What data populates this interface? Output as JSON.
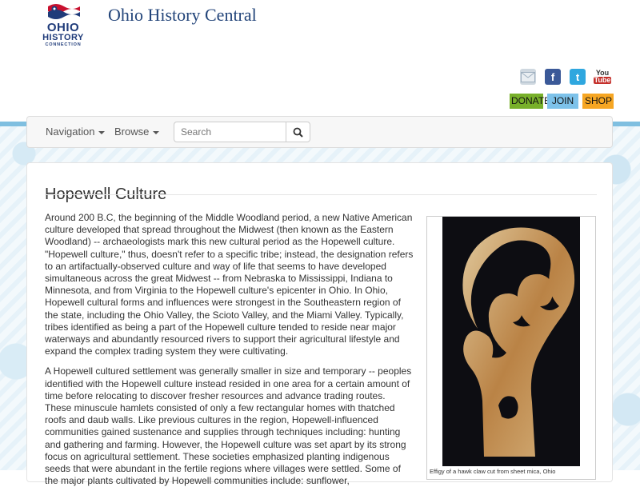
{
  "logo": {
    "line1": "OHIO",
    "line2": "HISTORY",
    "line3": "CONNECTION"
  },
  "site_title": "Ohio History Central",
  "social": {
    "mail_icon": "mail-icon",
    "facebook_glyph": "f",
    "twitter_glyph": "t",
    "youtube_you": "You",
    "youtube_tube": "Tube"
  },
  "actions": {
    "donate": "DONATE",
    "join": "JOIN",
    "shop": "SHOP"
  },
  "nav": {
    "navigation_label": "Navigation",
    "browse_label": "Browse",
    "search_placeholder": "Search"
  },
  "page": {
    "title": "Hopewell Culture",
    "paragraphs": [
      "Around 200 B.C, the beginning of the Middle Woodland period, a new Native American culture developed that spread throughout the Midwest (then known as the Eastern Woodland) -- archaeologists mark this new cultural period as the Hopewell culture. \"Hopewell culture,\" thus, doesn't refer to a specific tribe; instead, the designation refers to an artifactually-observed culture and way of life that seems to have developed simultaneous across the great Midwest -- from Nebraska to Mississippi, Indiana to Minnesota, and from Virginia to the Hopewell culture's epicenter in Ohio. In Ohio, Hopewell cultural forms and influences were strongest in the Southeastern region of the state, including the Ohio Valley, the Scioto Valley, and the Miami Valley. Typically, tribes identified as being a part of the Hopewell culture tended to reside near major waterways and abundantly resourced rivers to support their agricultural lifestyle and expand the complex trading system they were cultivating.",
      "A Hopewell cultured settlement was generally smaller in size and temporary -- peoples identified with the Hopewell culture instead resided in one area for a certain amount of time before relocating to discover fresher resources and advance trading routes. These minuscule hamlets consisted of only a few rectangular homes with thatched roofs and daub walls. Like previous cultures in the region, Hopewell-influenced communities gained sustenance and supplies through techniques including: hunting and gathering and farming. However, the Hopewell culture was set apart by its strong focus on agricultural settlement. These societies emphasized planting indigenous seeds that were abundant in the fertile regions where villages were settled. Some of the major plants cultivated by Hopewell communities include: sunflower,"
    ],
    "figure_caption": "Effigy of a hawk claw cut from sheet mica, Ohio"
  }
}
